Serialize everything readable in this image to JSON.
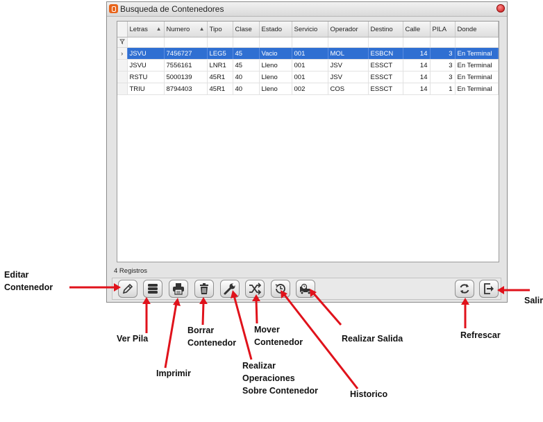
{
  "window": {
    "title": "Busqueda de Contenedores"
  },
  "grid": {
    "columns": [
      "Letras",
      "Numero",
      "Tipo",
      "Clase",
      "Estado",
      "Servicio",
      "Operador",
      "Destino",
      "Calle",
      "PILA",
      "Donde"
    ],
    "rows": [
      [
        "JSVU",
        "7456727",
        "LEG5",
        "45",
        "Vacio",
        "001",
        "MOL",
        "ESBCN",
        "14",
        "3",
        "En Terminal"
      ],
      [
        "JSVU",
        "7556161",
        "LNR1",
        "45",
        "Lleno",
        "001",
        "JSV",
        "ESSCT",
        "14",
        "3",
        "En Terminal"
      ],
      [
        "RSTU",
        "5000139",
        "45R1",
        "40",
        "Lleno",
        "001",
        "JSV",
        "ESSCT",
        "14",
        "3",
        "En Terminal"
      ],
      [
        "TRIU",
        "8794403",
        "45R1",
        "40",
        "Lleno",
        "002",
        "COS",
        "ESSCT",
        "14",
        "1",
        "En Terminal"
      ]
    ],
    "selected_row": 0,
    "record_count": "4 Registros"
  },
  "toolbar": [
    {
      "name": "edit-button",
      "icon": "pencil-icon",
      "label": "Editar Contenedor"
    },
    {
      "name": "view-stack-button",
      "icon": "stack-icon",
      "label": "Ver Pila"
    },
    {
      "name": "print-button",
      "icon": "printer-icon",
      "label": "Imprimir"
    },
    {
      "name": "delete-button",
      "icon": "trash-icon",
      "label": "Borrar Contenedor"
    },
    {
      "name": "operations-button",
      "icon": "wrench-icon",
      "label": "Realizar Operaciones Sobre Contenedor"
    },
    {
      "name": "move-button",
      "icon": "shuffle-icon",
      "label": "Mover Contenedor"
    },
    {
      "name": "history-button",
      "icon": "history-icon",
      "label": "Historico"
    },
    {
      "name": "exit-container-button",
      "icon": "truck-clock-icon",
      "label": "Realizar Salida"
    },
    {
      "name": "refresh-button",
      "icon": "refresh-icon",
      "label": "Refrescar"
    },
    {
      "name": "close-window-button",
      "icon": "exit-icon",
      "label": "Salir"
    }
  ],
  "annotations": {
    "editar": [
      "Editar",
      "Contenedor"
    ],
    "ver_pila": "Ver Pila",
    "imprimir": "Imprimir",
    "borrar": [
      "Borrar",
      "Contenedor"
    ],
    "realizar_operaciones": [
      "Realizar",
      "Operaciones",
      "Sobre Contenedor"
    ],
    "mover": [
      "Mover",
      "Contenedor"
    ],
    "historico": "Historico",
    "realizar_salida": "Realizar Salida",
    "refrescar": "Refrescar",
    "salir": "Salir"
  },
  "colors": {
    "selection": "#2f6fd2",
    "arrow": "#e0121b",
    "app_icon": "#e8641b",
    "close": "#c81010"
  }
}
